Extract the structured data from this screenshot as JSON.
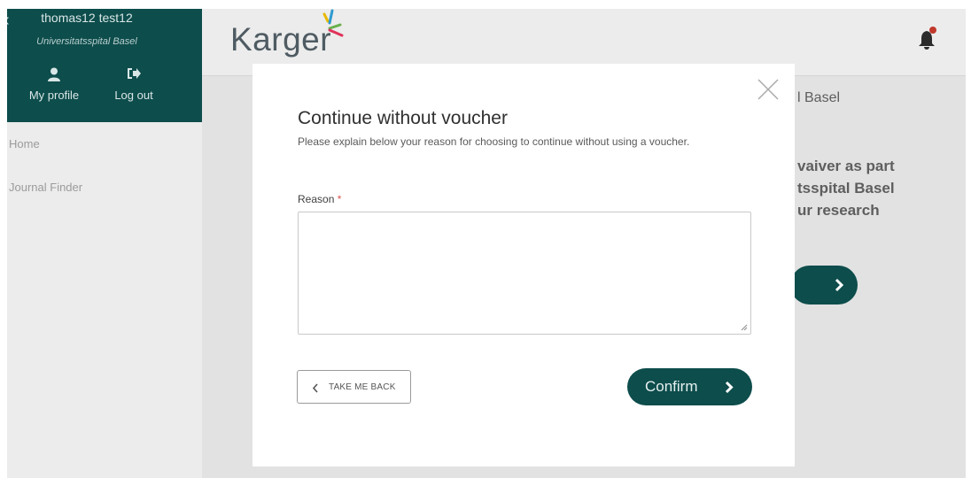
{
  "sidebar": {
    "user_name": "thomas12 test12",
    "institution": "Universitatsspital Basel",
    "my_profile_label": "My profile",
    "logout_label": "Log out",
    "nav_items": [
      {
        "label": "Home"
      },
      {
        "label": "Journal Finder"
      }
    ]
  },
  "header": {
    "logo_text": "Karger",
    "logo_colors": [
      "#e6b800",
      "#2e9ad0",
      "#e0325a",
      "#6ab04c"
    ]
  },
  "background_text": {
    "line1": "l Basel",
    "line2": "vaiver as part",
    "line3": "tsspital Basel",
    "line4": "ur research"
  },
  "modal": {
    "title": "Continue without voucher",
    "description": "Please explain below your reason for choosing to continue without using a voucher.",
    "reason_label": "Reason",
    "required_mark": "*",
    "reason_value": "",
    "back_label": "TAKE ME BACK",
    "confirm_label": "Confirm"
  },
  "colors": {
    "brand_dark": "#0d4d4c",
    "required": "#d9534f",
    "notification_dot": "#c0392b"
  },
  "icons": [
    "user-icon",
    "logout-icon",
    "bell-icon",
    "close-icon",
    "chevron-left-icon",
    "chevron-right-icon"
  ]
}
